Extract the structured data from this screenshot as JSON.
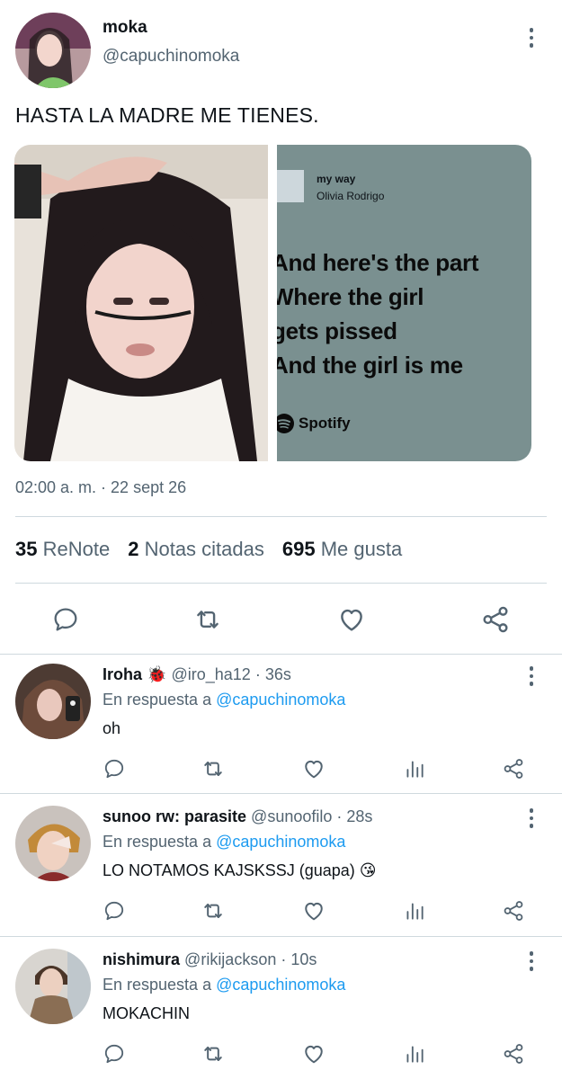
{
  "main_tweet": {
    "name": "moka",
    "handle": "@capuchinomoka",
    "text": "HASTA LA MADRE ME TIENES.",
    "lyric_card": {
      "song_title": "my way",
      "artist": "Olivia Rodrigo",
      "lyrics": "And here's the part\nWhere the girl\ngets pissed\nAnd the girl is me",
      "brand": "Spotify"
    },
    "timestamp": "02:00 a. m. · 22 sept 26",
    "stats": {
      "renotes_count": "35",
      "renotes_label": "ReNote",
      "quotes_count": "2",
      "quotes_label": "Notas citadas",
      "likes_count": "695",
      "likes_label": "Me gusta"
    },
    "actions": [
      "reply-icon",
      "renote-icon",
      "like-icon",
      "share-icon"
    ]
  },
  "replies": [
    {
      "name": "Iroha",
      "emoji": "🐞",
      "handle": "@iro_ha12",
      "time": "· 36s",
      "replying_prefix": "En respuesta a",
      "replying_to": "@capuchinomoka",
      "text": "oh"
    },
    {
      "name": "sunoo rw: parasite",
      "emoji": "",
      "handle": "@sunoofilo",
      "time": "· 28s",
      "replying_prefix": "En respuesta a",
      "replying_to": "@capuchinomoka",
      "text": "LO NOTAMOS KAJSKSSJ (guapa) 😘"
    },
    {
      "name": "nishimura",
      "emoji": "",
      "handle": "@rikijackson",
      "time": "· 10s",
      "replying_prefix": "En respuesta a",
      "replying_to": "@capuchinomoka",
      "text": "MOKACHIN"
    }
  ],
  "colors": {
    "text_primary": "#0f1419",
    "text_secondary": "#536471",
    "link": "#1d9bf0",
    "divider": "#cfd9de",
    "lyric_card_bg": "#7a9090"
  }
}
